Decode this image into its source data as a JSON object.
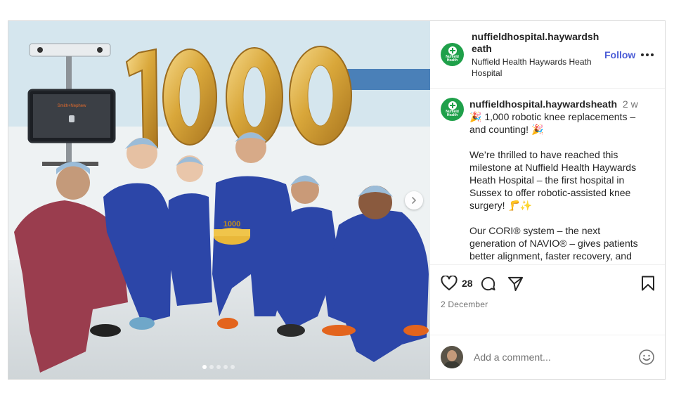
{
  "post": {
    "author": {
      "username": "nuffieldhospital.haywardsheath",
      "display_name": "Nuffield Health Haywards Heath Hospital",
      "avatar_text": "Nuffield Health"
    },
    "header": {
      "follow_label": "Follow"
    },
    "caption": {
      "username": "nuffieldhospital.haywardsheath",
      "time": "2 w",
      "paragraphs": [
        "🎉 1,000 robotic knee replacements – and counting! 🎉",
        "We’re thrilled to have reached this milestone at Nuffield Health Haywards Heath Hospital – the first hospital in Sussex to offer robotic-assisted knee surgery! 🦵✨",
        "Our CORI® system – the next generation of NAVIO® – gives patients better alignment, faster recovery, and improved long-term outcomes."
      ]
    },
    "likes": "28",
    "date": "2 December",
    "comment": {
      "placeholder": "Add a comment..."
    },
    "media": {
      "balloon_text": "1000",
      "cake_text": "1000",
      "monitor_brand": "Smith+Nephew",
      "carousel": {
        "count": 5,
        "active": 0
      }
    }
  },
  "colors": {
    "brand_green": "#1fa04a",
    "follow_blue": "#4b5cd6",
    "scrubs_navy": "#2c46a8",
    "scrubs_maroon": "#9a3d4e",
    "balloon_gold": "#d9a73a"
  },
  "icons": [
    "heart-icon",
    "comment-icon",
    "share-icon",
    "bookmark-icon",
    "emoji-icon",
    "more-icon",
    "chevron-right-icon"
  ]
}
